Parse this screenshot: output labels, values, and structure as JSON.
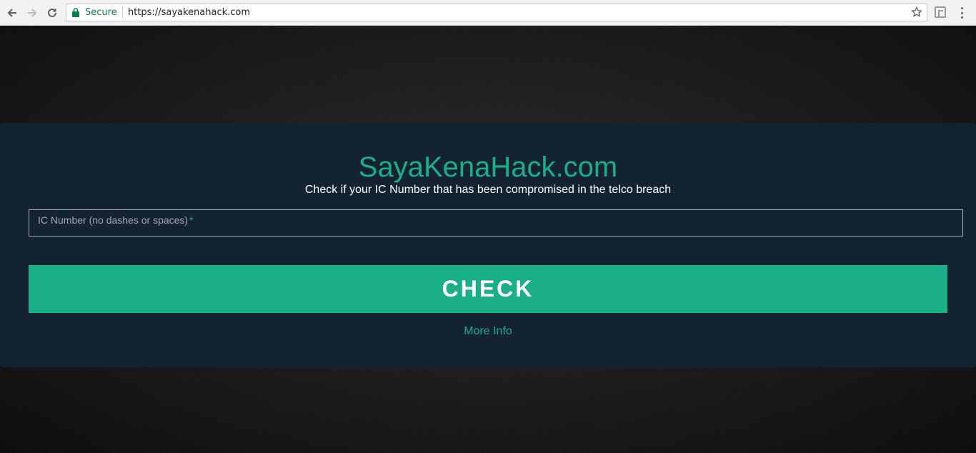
{
  "browser": {
    "secure_label": "Secure",
    "url": "https://sayakenahack.com",
    "icons": [
      "back-icon",
      "forward-icon",
      "reload-icon",
      "lock-icon",
      "star-icon",
      "extension-icon",
      "menu-icon"
    ]
  },
  "page": {
    "title": "SayaKenaHack.com",
    "subtitle": "Check if your IC Number that has been compromised in the telco breach",
    "ic_field_label": "IC Number (no dashes or spaces)",
    "ic_field_required": "*",
    "check_button": "CHECK",
    "more_info_link": "More Info"
  },
  "colors": {
    "accent": "#1aaf87",
    "panel": "#142331",
    "secure_green": "#0b8043"
  }
}
